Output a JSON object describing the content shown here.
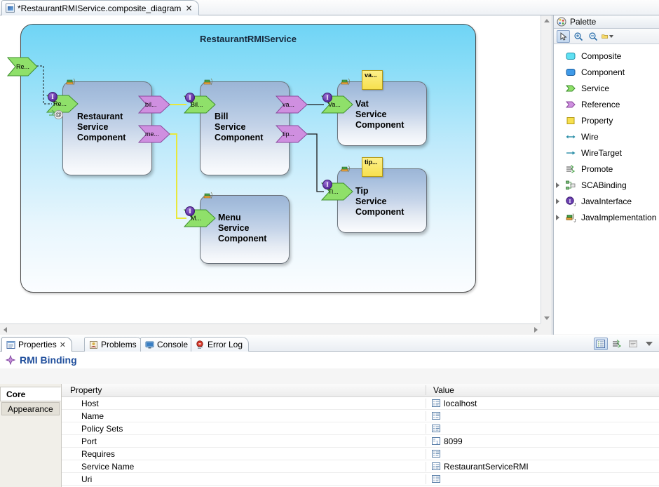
{
  "editor": {
    "tab": {
      "icon": "diagram-file-icon",
      "title": "*RestaurantRMIService.composite_diagram",
      "close": "✕"
    }
  },
  "diagram": {
    "composite_title": "RestaurantRMIService",
    "promoted_service": {
      "label": "Re...",
      "name": "promoted-restaurant-service"
    },
    "components": [
      {
        "id": "restaurant",
        "name": "Restaurant\nService\nComponent",
        "services": [
          {
            "label": "Re..."
          }
        ],
        "references": [
          {
            "label": "bil..."
          },
          {
            "label": "me..."
          }
        ],
        "properties": []
      },
      {
        "id": "bill",
        "name": "Bill\nService\nComponent",
        "services": [
          {
            "label": "Bil..."
          }
        ],
        "references": [
          {
            "label": "va..."
          },
          {
            "label": "tip..."
          }
        ],
        "properties": []
      },
      {
        "id": "menu",
        "name": "Menu\nService\nComponent",
        "services": [
          {
            "label": "M..."
          }
        ],
        "references": [],
        "properties": []
      },
      {
        "id": "vat",
        "name": "Vat\nService\nComponent",
        "services": [
          {
            "label": "Va..."
          }
        ],
        "references": [],
        "properties": [
          {
            "label": "va..."
          }
        ]
      },
      {
        "id": "tip",
        "name": "Tip\nService\nComponent",
        "services": [
          {
            "label": "Ti..."
          }
        ],
        "references": [],
        "properties": [
          {
            "label": "tip..."
          }
        ]
      }
    ],
    "badges": {
      "interface": "I",
      "binding": "@"
    }
  },
  "palette": {
    "title": "Palette",
    "tools": [
      {
        "name": "select-tool",
        "icon": "arrow-pointer-icon"
      },
      {
        "name": "zoom-in-tool",
        "icon": "magnifier-plus-icon"
      },
      {
        "name": "zoom-out-tool",
        "icon": "magnifier-minus-icon"
      },
      {
        "name": "palette-layout-menu",
        "icon": "folder-icon"
      }
    ],
    "items": [
      {
        "label": "Composite",
        "icon": "composite-icon",
        "expandable": false
      },
      {
        "label": "Component",
        "icon": "component-icon",
        "expandable": false
      },
      {
        "label": "Service",
        "icon": "service-icon",
        "expandable": false
      },
      {
        "label": "Reference",
        "icon": "reference-icon",
        "expandable": false
      },
      {
        "label": "Property",
        "icon": "property-icon",
        "expandable": false
      },
      {
        "label": "Wire",
        "icon": "wire-icon",
        "expandable": false
      },
      {
        "label": "WireTarget",
        "icon": "wiretarget-icon",
        "expandable": false
      },
      {
        "label": "Promote",
        "icon": "promote-icon",
        "expandable": false
      },
      {
        "label": "SCABinding",
        "icon": "scabinding-icon",
        "expandable": true
      },
      {
        "label": "JavaInterface",
        "icon": "javainterface-icon",
        "expandable": true
      },
      {
        "label": "JavaImplementation",
        "icon": "javaimplementation-icon",
        "expandable": true
      }
    ]
  },
  "properties_view": {
    "tabs": [
      {
        "label": "Properties",
        "icon": "properties-icon",
        "active": true,
        "close": "✕"
      },
      {
        "label": "Problems",
        "icon": "problems-icon",
        "active": false
      },
      {
        "label": "Console",
        "icon": "console-icon",
        "active": false
      },
      {
        "label": "Error Log",
        "icon": "error-log-icon",
        "active": false
      }
    ],
    "toolbar": [
      {
        "name": "show-categories-button",
        "icon": "tree-icon",
        "pressed": true
      },
      {
        "name": "show-advanced-button",
        "icon": "filter-icon",
        "pressed": false
      },
      {
        "name": "restore-button",
        "icon": "restore-icon",
        "pressed": false
      },
      {
        "name": "view-menu-button",
        "icon": "chevron-down-icon",
        "pressed": false
      }
    ],
    "title": "RMI Binding",
    "title_icon": "rmi-binding-icon",
    "side_tabs": [
      {
        "label": "Core",
        "active": true
      },
      {
        "label": "Appearance",
        "active": false
      }
    ],
    "columns": [
      "Property",
      "Value"
    ],
    "rows": [
      {
        "property": "Host",
        "value": "localhost",
        "icon": "text-value-icon"
      },
      {
        "property": "Name",
        "value": "",
        "icon": "text-value-icon"
      },
      {
        "property": "Policy Sets",
        "value": "",
        "icon": "text-value-icon"
      },
      {
        "property": "Port",
        "value": "8099",
        "icon": "number-value-icon"
      },
      {
        "property": "Requires",
        "value": "",
        "icon": "text-value-icon"
      },
      {
        "property": "Service Name",
        "value": "RestaurantServiceRMI",
        "icon": "text-value-icon"
      },
      {
        "property": "Uri",
        "value": "",
        "icon": "text-value-icon"
      }
    ]
  },
  "colors": {
    "composite_fill_top": "#6fd4f5",
    "component_fill": "#a8c0de",
    "service_green": "#8fe06a",
    "reference_purple": "#cf8fe0",
    "property_yellow": "#f7e04e",
    "wire_yellow": "#e8e83c",
    "wire_black": "#1a1a1a",
    "title_blue": "#1f4e9c"
  }
}
